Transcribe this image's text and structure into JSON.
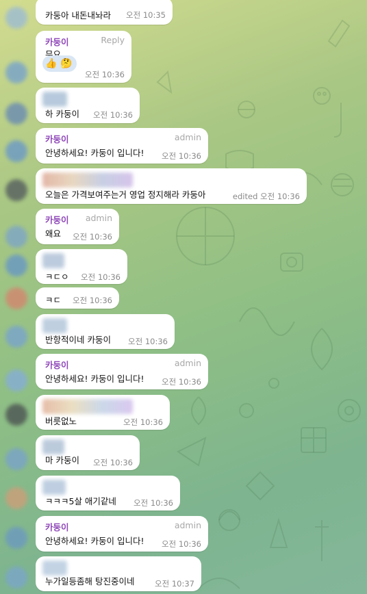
{
  "messages": [
    {
      "text": "카둥아 내돈내놔라",
      "time": "오전 10:35"
    },
    {
      "sender": "카둥이",
      "role": "Reply",
      "text": "무요",
      "time": "오전 10:36",
      "reactions": [
        "thumbs-up",
        "thinking-face"
      ]
    },
    {
      "text": "하 카둥이",
      "time": "오전 10:36"
    },
    {
      "sender": "카둥이",
      "role": "admin",
      "text": "안녕하세요! 카둥이 입니다!",
      "time": "오전 10:36"
    },
    {
      "text": "오늘은 가격보여주는거 영업 정지해라 카둥아",
      "time": "edited 오전 10:36"
    },
    {
      "sender": "카둥이",
      "role": "admin",
      "text": "왜요",
      "time": "오전 10:36"
    },
    {
      "text": "ㅋㄷㅇ",
      "time": "오전 10:36"
    },
    {
      "text": "ㅋㄷ",
      "time": "오전 10:36"
    },
    {
      "text": "반항적이네 카둥이",
      "time": "오전 10:36"
    },
    {
      "sender": "카둥이",
      "role": "admin",
      "text": "안녕하세요! 카둥이 입니다!",
      "time": "오전 10:36"
    },
    {
      "text": "버릇없노",
      "time": "오전 10:36"
    },
    {
      "text": "마 카둥이",
      "time": "오전 10:36"
    },
    {
      "text": "ㅋㅋㅋ5살 애기같네",
      "time": "오전 10:36"
    },
    {
      "sender": "카둥이",
      "role": "admin",
      "text": "안녕하세요! 카둥이 입니다!",
      "time": "오전 10:36"
    },
    {
      "text": "누가일등좀해 탕진중이네",
      "time": "오전 10:37"
    }
  ],
  "colors": {
    "sender": "#8e46b8",
    "bubble": "#ffffff",
    "role": "#a7a7a7",
    "time": "#8a8a8a"
  }
}
